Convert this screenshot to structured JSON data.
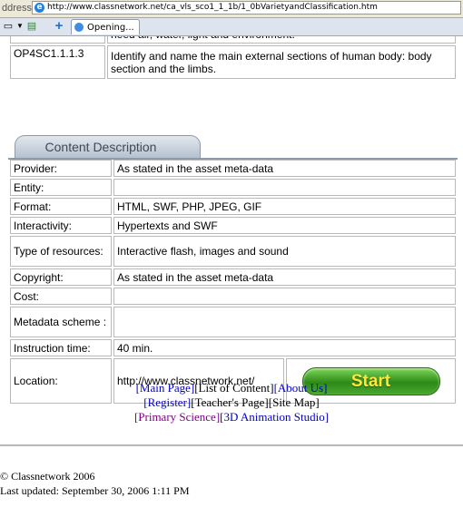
{
  "browser": {
    "address_label": "ddress",
    "url": "http://www.classnetwork.net/ca_vls_sco1_1_1b/1_0bVarietyandClassification.htm",
    "tab_label": "Opening..."
  },
  "objectives": [
    {
      "code": "",
      "text": "need air, water, light and environment."
    },
    {
      "code": "OP4SC1.1.1.3",
      "text": "Identify and name the main external sections of human body: body section and the limbs."
    }
  ],
  "section_title": "Content Description",
  "content_rows": [
    {
      "label": "Provider:",
      "value": "As stated in the asset meta-data"
    },
    {
      "label": "Entity:",
      "value": ""
    },
    {
      "label": "Format:",
      "value": "HTML, SWF, PHP, JPEG, GIF"
    },
    {
      "label": "Interactivity:",
      "value": "Hypertexts and SWF"
    },
    {
      "label": "Type of resources:",
      "value": "Interactive flash, images and sound"
    },
    {
      "label": "Copyright:",
      "value": "As stated in the asset meta-data"
    },
    {
      "label": "Cost:",
      "value": ""
    },
    {
      "label": "Metadata scheme :",
      "value": ""
    },
    {
      "label": "Instruction time:",
      "value": "40 min."
    }
  ],
  "location": {
    "label": "Location:",
    "value": "http://www.classnetwork.net/"
  },
  "start_label": "Start",
  "links": {
    "main_page": "[Main Page]",
    "list_of_content": "[List of Content]",
    "about_us": "[About Us]",
    "register": "[Register]",
    "teachers_page": "[Teacher's Page]",
    "site_map": "[Site Map]",
    "primary_science": "[Primary Science]",
    "animation_studio": "[3D Animation Studio]"
  },
  "footer": {
    "copyright": "© Classnetwork 2006",
    "last_updated": "Last updated: September 30, 2006 1:11 PM"
  },
  "colors": {
    "link": "#0000cc",
    "visited_link": "#800080",
    "start_button": "#3a9a20",
    "start_text": "#ffe63a"
  }
}
